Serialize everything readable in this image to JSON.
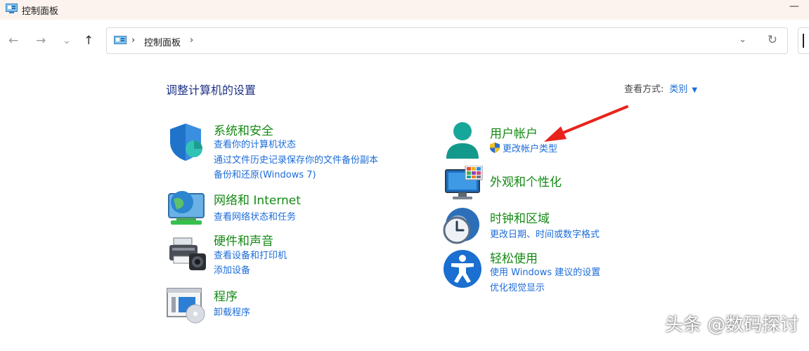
{
  "window": {
    "title": "控制面板",
    "minimize_glyph": "—"
  },
  "nav": {
    "back_glyph": "←",
    "forward_glyph": "→",
    "recent_glyph": "⌄",
    "up_glyph": "↑",
    "breadcrumb_sep": "›",
    "breadcrumb": "控制面板",
    "dropdown_glyph": "⌄",
    "refresh_glyph": "↻"
  },
  "main": {
    "heading": "调整计算机的设置",
    "view_by": {
      "label": "查看方式:",
      "value": "类别",
      "arrow": "▼"
    }
  },
  "categories": {
    "system_security": {
      "title": "系统和安全",
      "links": [
        "查看你的计算机状态",
        "通过文件历史记录保存你的文件备份副本",
        "备份和还原(Windows 7)"
      ]
    },
    "network": {
      "title": "网络和 Internet",
      "links": [
        "查看网络状态和任务"
      ]
    },
    "hardware": {
      "title": "硬件和声音",
      "links": [
        "查看设备和打印机",
        "添加设备"
      ]
    },
    "programs": {
      "title": "程序",
      "links": [
        "卸载程序"
      ]
    },
    "user_accounts": {
      "title": "用户帐户",
      "links": [
        "更改帐户类型"
      ]
    },
    "appearance": {
      "title": "外观和个性化",
      "links": []
    },
    "clock_region": {
      "title": "时钟和区域",
      "links": [
        "更改日期、时间或数字格式"
      ]
    },
    "ease_of_access": {
      "title": "轻松使用",
      "links": [
        "使用 Windows 建议的设置",
        "优化视觉显示"
      ]
    }
  },
  "icons": {
    "system_security": "shield-icon",
    "network": "globe-monitor-icon",
    "hardware": "printer-speaker-icon",
    "programs": "program-disc-icon",
    "user_accounts": "user-icon",
    "appearance": "monitor-palette-icon",
    "clock_region": "clock-globe-icon",
    "ease_of_access": "accessibility-icon",
    "uac": "uac-shield-icon"
  },
  "colors": {
    "category_title": "#148a14",
    "link": "#1c6cd8",
    "heading": "#1e3287",
    "annotation_arrow": "#e8231c"
  },
  "watermark": "头条 @数码探讨"
}
